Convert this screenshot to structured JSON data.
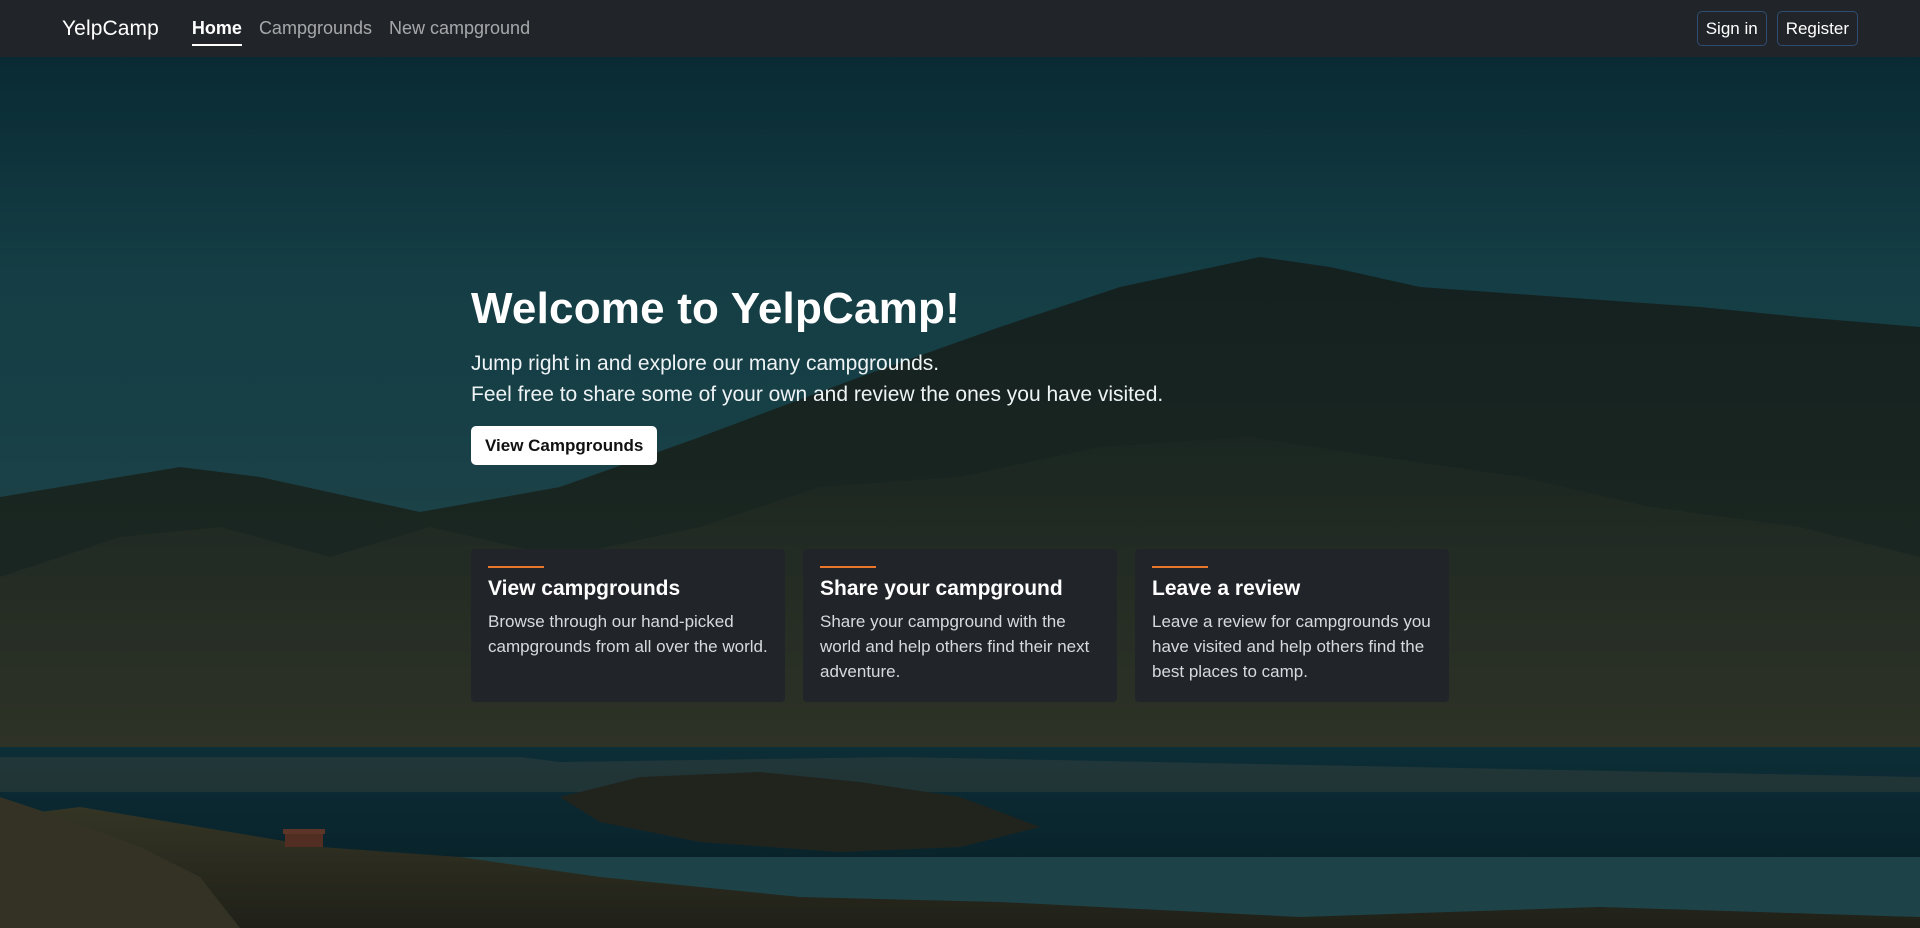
{
  "navbar": {
    "brand": "YelpCamp",
    "links": [
      {
        "label": "Home",
        "active": true
      },
      {
        "label": "Campgrounds",
        "active": false
      },
      {
        "label": "New campground",
        "active": false
      }
    ],
    "sign_in": "Sign in",
    "register": "Register"
  },
  "hero": {
    "title": "Welcome to YelpCamp!",
    "lead_line1": "Jump right in and explore our many campgrounds.",
    "lead_line2": "Feel free to share some of your own and review the ones you have visited.",
    "cta": "View Campgrounds"
  },
  "cards": [
    {
      "title": "View campgrounds",
      "text": "Browse through our hand-picked campgrounds from all over the world."
    },
    {
      "title": "Share your campground",
      "text": "Share your campground with the world and help others find their next adventure."
    },
    {
      "title": "Leave a review",
      "text": "Leave a review for campgrounds you have visited and help others find the best places to camp."
    }
  ],
  "colors": {
    "navbar_bg": "#212529",
    "card_bg": "#212529",
    "accent_rule": "#e8762b",
    "button_outline": "#2f4c72"
  }
}
